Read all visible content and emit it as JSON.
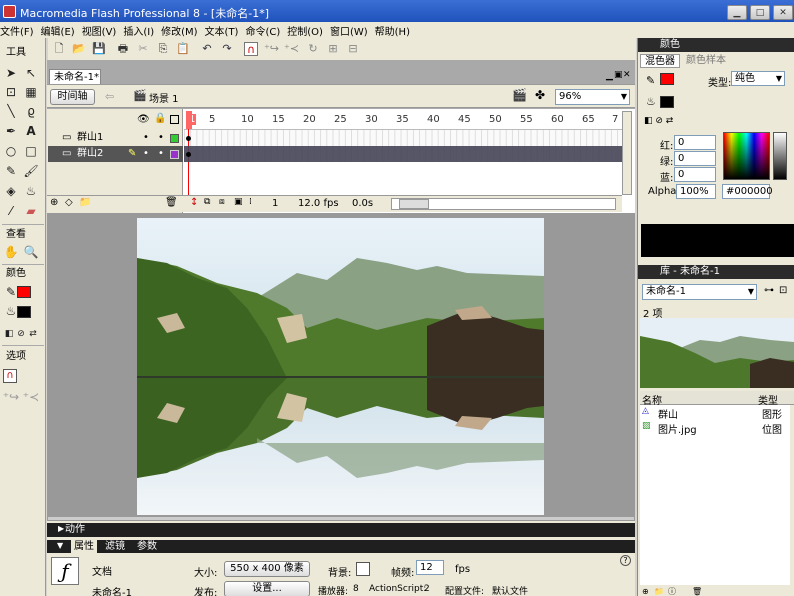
{
  "window": {
    "title": "Macromedia Flash Professional 8 - [未命名-1*]",
    "min": "▁",
    "max": "□",
    "close": "✕"
  },
  "menu": [
    "文件(F)",
    "编辑(E)",
    "视图(V)",
    "插入(I)",
    "修改(M)",
    "文本(T)",
    "命令(C)",
    "控制(O)",
    "窗口(W)",
    "帮助(H)"
  ],
  "tools_panel": {
    "title": "工具",
    "view_label": "查看",
    "color_label": "颜色",
    "options_label": "选项"
  },
  "document": {
    "tab": "未命名-1*",
    "timeline_button": "时间轴",
    "scene": "场景 1",
    "zoom": "96%"
  },
  "timeline": {
    "ruler": [
      "1",
      "5",
      "10",
      "15",
      "20",
      "25",
      "30",
      "35",
      "40",
      "45",
      "50",
      "55",
      "60",
      "65",
      "7"
    ],
    "layers": [
      {
        "name": "群山1",
        "selected": false,
        "color": "#33cc33"
      },
      {
        "name": "群山2",
        "selected": true,
        "color": "#9933cc"
      }
    ],
    "current_frame": "1",
    "fps": "12.0 fps",
    "time": "0.0s"
  },
  "color_mixer": {
    "panel_title": "颜色",
    "tab_mixer": "混色器",
    "tab_swatches": "颜色样本",
    "type_label": "类型:",
    "type_value": "纯色",
    "red_label": "红:",
    "red": "0",
    "green_label": "绿:",
    "green": "0",
    "blue_label": "蓝:",
    "blue": "0",
    "alpha_label": "Alpha:",
    "alpha": "100%",
    "hex": "#000000",
    "stroke_color": "#ff0000",
    "fill_color": "#000000"
  },
  "library": {
    "panel_title": "库 - 未命名-1",
    "document": "未命名-1",
    "count": "2 项",
    "col_name": "名称",
    "col_type": "类型",
    "items": [
      {
        "name": "群山",
        "type": "图形"
      },
      {
        "name": "图片.jpg",
        "type": "位图"
      }
    ]
  },
  "actions": {
    "title": "动作"
  },
  "properties": {
    "tab_props": "属性",
    "tab_filters": "滤镜",
    "tab_params": "参数",
    "doc_label": "文档",
    "doc_name": "未命名-1",
    "size_label": "大小:",
    "size_value": "550 x 400 像素",
    "bg_label": "背景:",
    "fps_label": "帧频:",
    "fps_value": "12",
    "fps_unit": "fps",
    "publish_label": "发布:",
    "settings_button": "设置...",
    "player_label": "播放器:",
    "player_value": "8",
    "as_label": "ActionScript:",
    "as_value": "2",
    "profile_label": "配置文件:",
    "profile_value": "默认文件"
  }
}
